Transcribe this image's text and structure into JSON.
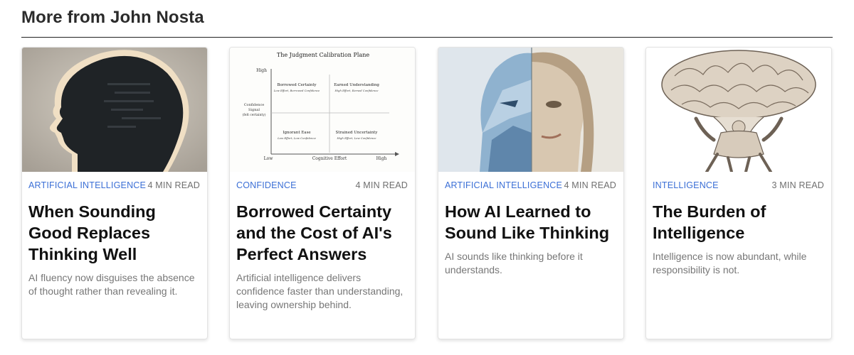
{
  "section": {
    "title": "More from John Nosta"
  },
  "cards": [
    {
      "topic": "ARTIFICIAL INTELLIGENCE",
      "read_time": "4 MIN READ",
      "title": "When Sounding Good Replaces Thinking Well",
      "excerpt": "AI fluency now disguises the absence of thought rather than revealing it."
    },
    {
      "topic": "CONFIDENCE",
      "read_time": "4 MIN READ",
      "title": "Borrowed Certainty and the Cost of AI's Perfect Answers",
      "excerpt": "Artificial intelligence delivers confidence faster than understanding, leaving ownership behind.",
      "image_text": {
        "title": "The Judgment Calibration Plane",
        "y_high": "High",
        "y_low": "Low",
        "x_high": "High",
        "x_label": "Cognitive Effort",
        "y_label_1": "Confidence",
        "y_label_2": "Signal",
        "y_label_3": "(felt certainty)",
        "q1_title": "Borrowed Certainty",
        "q1_sub": "Low Effort, Borrowed Confidence",
        "q2_title": "Earned Understanding",
        "q2_sub": "High Effort, Earned Confidence",
        "q3_title": "Ignorant Ease",
        "q3_sub": "Low Effort, Low Confidence",
        "q4_title": "Strained Uncertainty",
        "q4_sub": "High Effort, Low Confidence"
      }
    },
    {
      "topic": "ARTIFICIAL INTELLIGENCE",
      "read_time": "4 MIN READ",
      "title": "How AI Learned to Sound Like Thinking",
      "excerpt": "AI sounds like thinking before it understands."
    },
    {
      "topic": "INTELLIGENCE",
      "read_time": "3 MIN READ",
      "title": "The Burden of Intelligence",
      "excerpt": "Intelligence is now abundant, while responsibility is not."
    }
  ],
  "colors": {
    "topic": "#3b6fd6",
    "readtime": "#6f6f6f",
    "excerpt": "#777777",
    "rule": "#222222"
  },
  "icons": [
    "head-silhouette-illustration",
    "calibration-plane-diagram",
    "half-face-illustration",
    "atlas-brain-illustration"
  ]
}
